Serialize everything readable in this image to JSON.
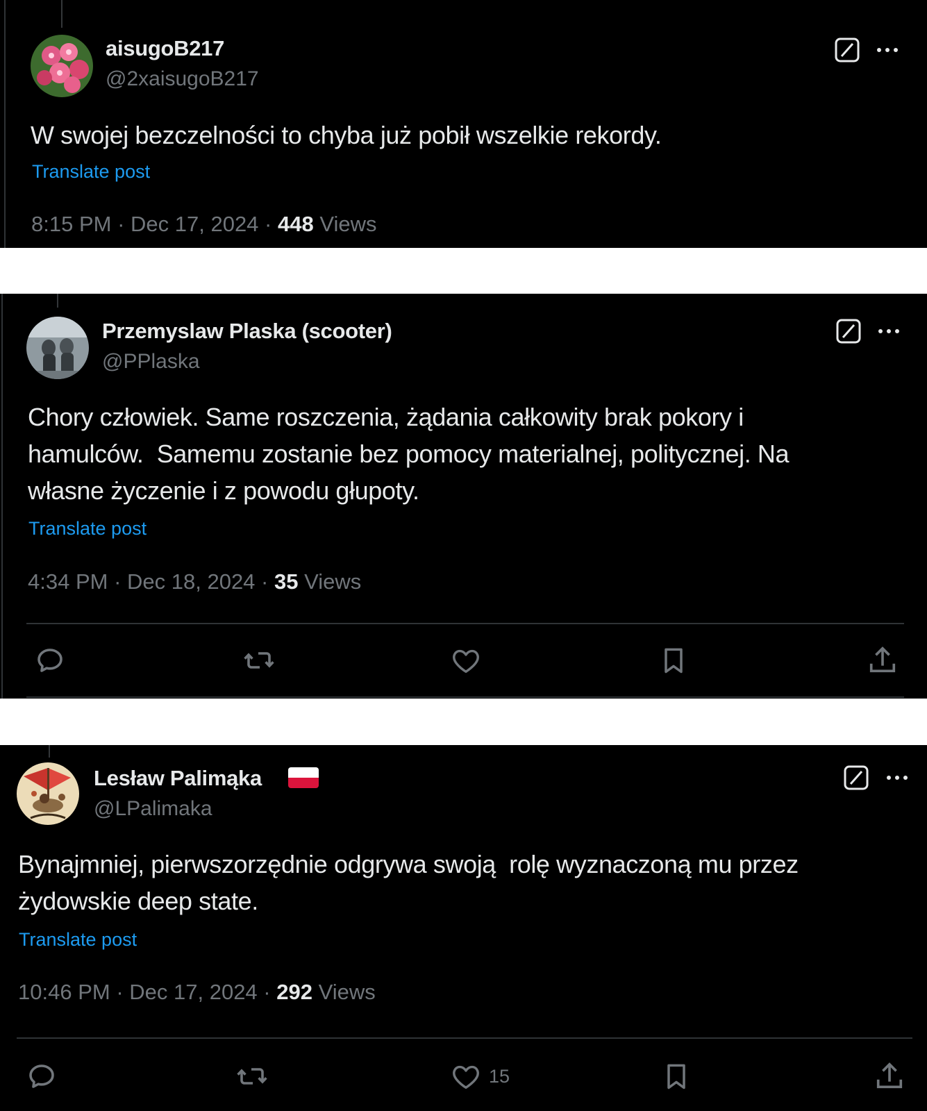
{
  "posts": [
    {
      "display_name": "aisugoB217",
      "handle": "@2xaisugoB217",
      "text": "W swojej bezczelności to chyba już pobił wszelkie rekordy.",
      "translate_label": "Translate post",
      "time": "8:15 PM",
      "date": "Dec 17, 2024",
      "views_count": "448",
      "views_label": "Views"
    },
    {
      "display_name": "Przemyslaw Plaska (scooter)",
      "handle": "@PPlaska",
      "text_lines": [
        "Chory człowiek. Same roszczenia, żądania całkowity brak pokory i",
        "hamulców.  Samemu zostanie bez pomocy materialnej, politycznej. Na",
        "własne życzenie i z powodu głupoty."
      ],
      "translate_label": "Translate post",
      "time": "4:34 PM",
      "date": "Dec 18, 2024",
      "views_count": "35",
      "views_label": "Views"
    },
    {
      "display_name": "Lesław Palimąka",
      "flag_icon": "poland-flag-icon",
      "handle": "@LPalimaka",
      "text_lines": [
        "Bynajmniej, pierwszorzędnie odgrywa swoją  rolę wyznaczoną mu przez",
        "żydowskie deep state."
      ],
      "translate_label": "Translate post",
      "time": "10:46 PM",
      "date": "Dec 17, 2024",
      "views_count": "292",
      "views_label": "Views",
      "like_count": "15"
    }
  ],
  "icons": {
    "grok": "grok-icon",
    "more": "more-icon",
    "reply": "reply-icon",
    "repost": "repost-icon",
    "like": "like-icon",
    "bookmark": "bookmark-icon",
    "share": "share-icon"
  },
  "colors": {
    "background": "#000000",
    "text": "#e7e9ea",
    "secondary": "#71767b",
    "link": "#1d9bf0",
    "divider": "#2f3336"
  }
}
